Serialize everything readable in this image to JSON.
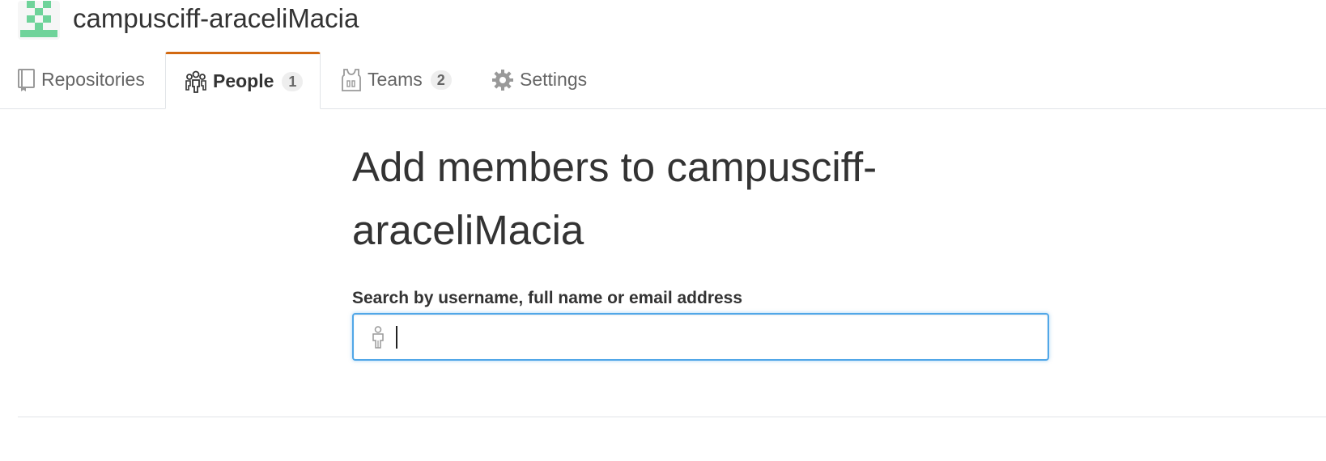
{
  "org": {
    "name": "campusciff-araceliMacia"
  },
  "tabs": [
    {
      "label": "Repositories",
      "icon": "repo-icon"
    },
    {
      "label": "People",
      "count": "1",
      "icon": "people-icon",
      "selected": true
    },
    {
      "label": "Teams",
      "count": "2",
      "icon": "jersey-icon"
    },
    {
      "label": "Settings",
      "icon": "gear-icon"
    }
  ],
  "main": {
    "title": "Add members to campusciff-araceliMacia",
    "search_label": "Search by username, full name or email address",
    "search_value": "",
    "search_placeholder": ""
  },
  "colors": {
    "accent_tab": "#d26911",
    "focus_border": "#51a7e8",
    "avatar_green": "#6fd39a"
  }
}
